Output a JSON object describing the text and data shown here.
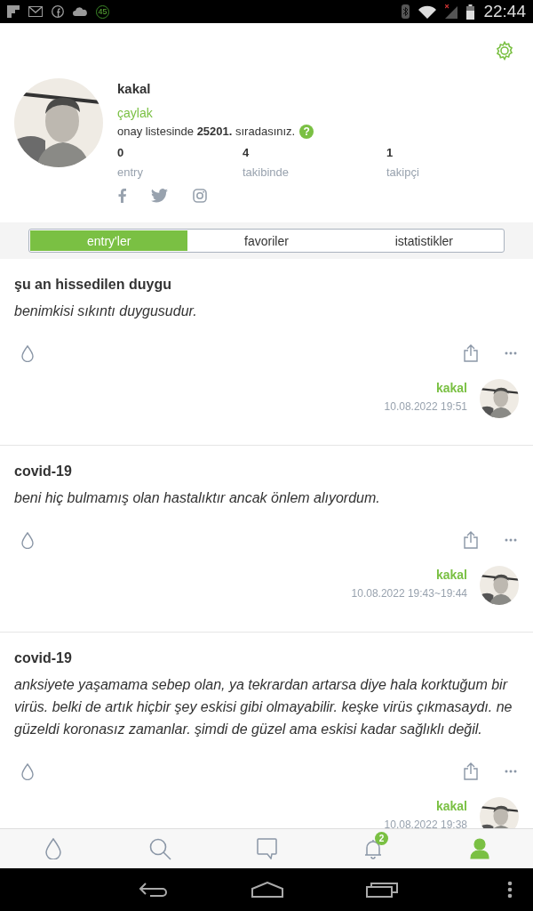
{
  "status_bar": {
    "notification_badge": "45",
    "time": "22:44"
  },
  "profile": {
    "username": "kakal",
    "rank": "çaylak",
    "queue_text": "onay listesinde **25201.** sıradasınız.",
    "help": "?",
    "stats": [
      {
        "value": "0",
        "label": "entry"
      },
      {
        "value": "4",
        "label": "takibinde"
      },
      {
        "value": "1",
        "label": "takipçi"
      }
    ]
  },
  "tabs": [
    {
      "label": "entry'ler",
      "selected": true
    },
    {
      "label": "favoriler",
      "selected": false
    },
    {
      "label": "istatistikler",
      "selected": false
    }
  ],
  "entries": [
    {
      "title": "şu an hissedilen duygu",
      "body": "benimkisi sıkıntı duygusudur.",
      "author": "kakal",
      "date": "10.08.2022 19:51"
    },
    {
      "title": "covid-19",
      "body": "beni hiç bulmamış olan hastalıktır ancak önlem alıyordum.",
      "author": "kakal",
      "date": "10.08.2022 19:43~19:44"
    },
    {
      "title": "covid-19",
      "body": "anksiyete yaşamama sebep olan, ya tekrardan artarsa diye hala korktuğum bir virüs. belki de artık hiçbir şey eskisi gibi olmayabilir. keşke virüs çıkmasaydı. ne güzeldi koronasız zamanlar. şimdi de güzel ama eskisi kadar sağlıklı değil.",
      "author": "kakal",
      "date": "10.08.2022 19:38"
    }
  ],
  "bottom_nav": [
    {
      "kind": "drop",
      "selected": false
    },
    {
      "kind": "search",
      "selected": false
    },
    {
      "kind": "message",
      "selected": false
    },
    {
      "kind": "bell",
      "selected": false,
      "badge": "2"
    },
    {
      "kind": "profile",
      "selected": true
    }
  ]
}
